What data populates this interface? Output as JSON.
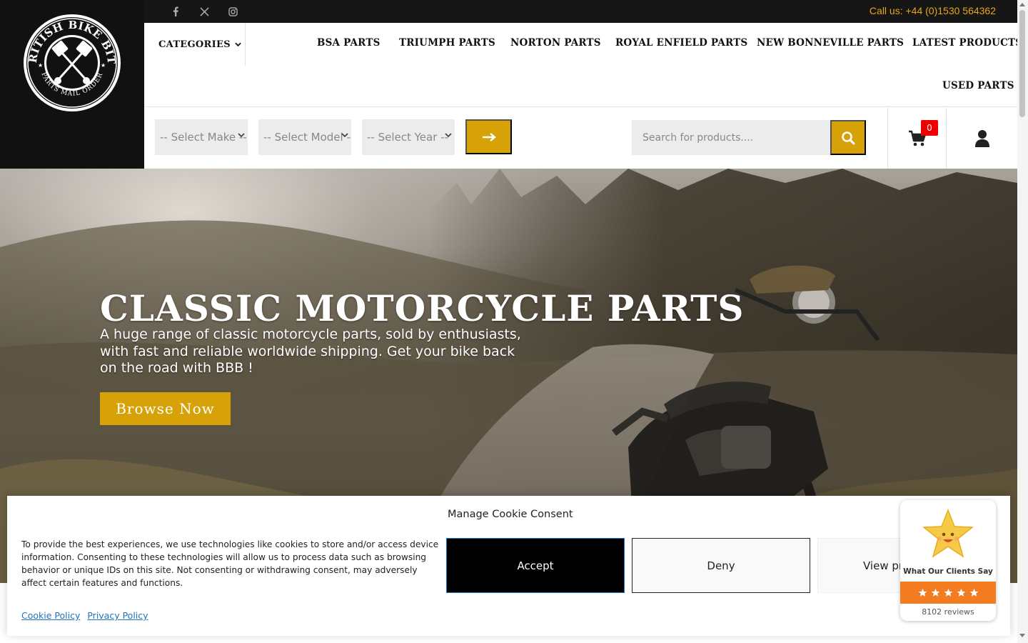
{
  "brand": {
    "logo_text_top": "BRITISH BIKE BITS",
    "logo_text_bottom": "PARTS MAIL ORDER"
  },
  "topbar": {
    "social": [
      "facebook-icon",
      "x-icon",
      "instagram-icon"
    ],
    "phone": "Call us: +44 (0)1530 564362"
  },
  "nav": {
    "categories_label": "CATEGORIES",
    "links": [
      "BSA PARTS",
      "TRIUMPH PARTS",
      "NORTON PARTS",
      "ROYAL ENFIELD PARTS",
      "NEW BONNEVILLE PARTS",
      "LATEST PRODUCTS",
      "USED PARTS"
    ]
  },
  "filter": {
    "make": "-- Select Make --",
    "model": "-- Select Model --",
    "year": "-- Select Year --"
  },
  "search": {
    "placeholder": "Search for products...."
  },
  "cart": {
    "count": "0"
  },
  "hero": {
    "title": "CLASSIC MOTORCYCLE PARTS",
    "subtitle": "A huge range of classic motorcycle parts, sold by enthusiasts, with fast and reliable worldwide shipping. Get your bike back on the road with BBB !",
    "button": "Browse Now"
  },
  "cookie": {
    "title": "Manage Cookie Consent",
    "text": "To provide the best experiences, we use technologies like cookies to store and/or access device information. Consenting to these technologies will allow us to process data such as browsing behavior or unique IDs on this site. Not consenting or withdrawing consent, may adversely affect certain features and functions.",
    "accept": "Accept",
    "deny": "Deny",
    "preferences": "View preferences",
    "cookie_policy": "Cookie Policy",
    "privacy_policy": "Privacy Policy"
  },
  "reviews": {
    "label": "What Our Clients Say",
    "count": "8102 reviews",
    "stars": 5
  },
  "colors": {
    "accent": "#d6a208",
    "phone": "#e3a615",
    "badge": "#ee0000",
    "review_bar": "#f47c20",
    "link": "#1e73be"
  }
}
